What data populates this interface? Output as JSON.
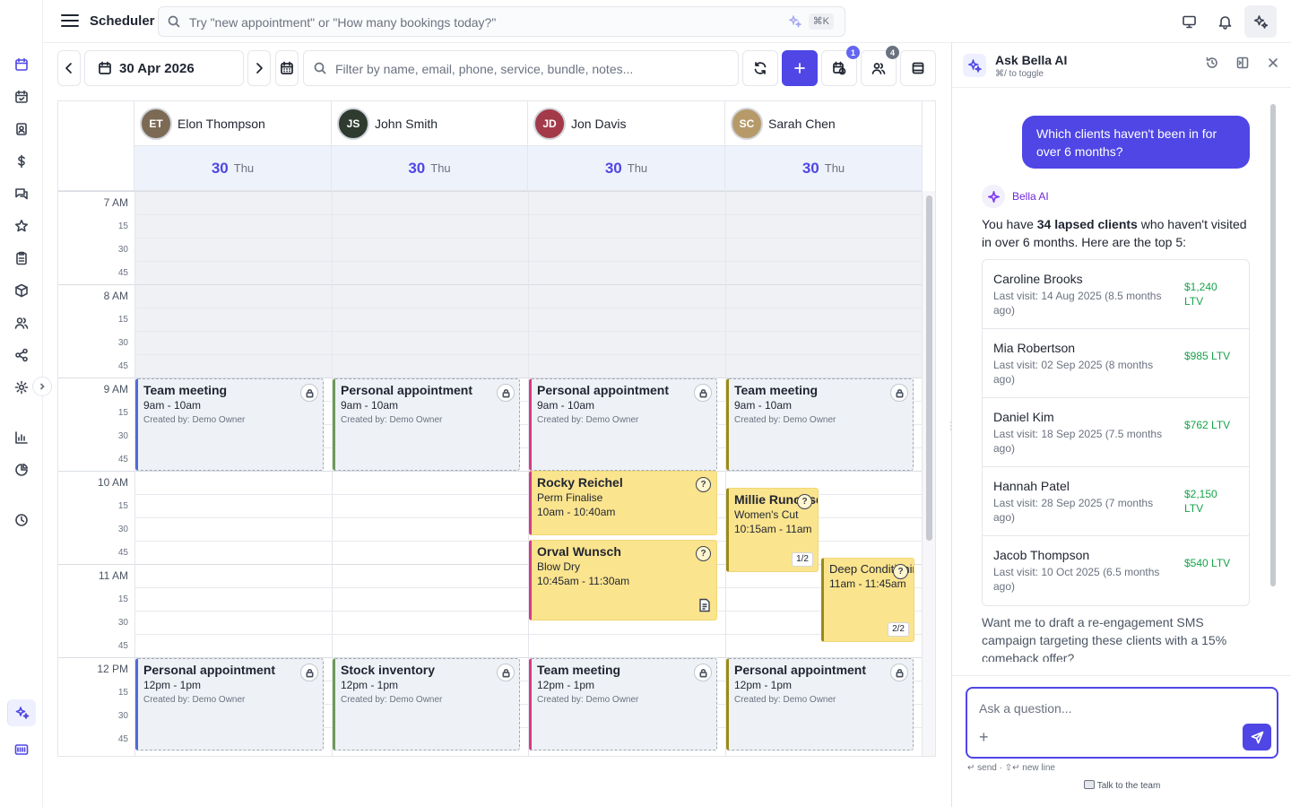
{
  "app": {
    "title": "Scheduler",
    "search_placeholder": "Try \"new appointment\" or \"How many bookings today?\"",
    "search_shortcut": "⌘K"
  },
  "rail": {
    "icons": [
      "calendar-icon",
      "calendar-check-icon",
      "contact-card-icon",
      "dollar-icon",
      "chat-icon",
      "star-icon",
      "clipboard-icon",
      "package-icon",
      "users-icon",
      "share-icon",
      "gear-icon",
      "bar-chart-icon",
      "pie-chart-icon",
      "clock-icon",
      "sparkles-icon",
      "keyboard-icon"
    ]
  },
  "toolbar": {
    "date": "30 Apr 2026",
    "filter_placeholder": "Filter by name, email, phone, service, bundle, notes...",
    "waitlist_badge": "1",
    "staff_badge": "4"
  },
  "calendar": {
    "staff": [
      {
        "name": "Elon Thompson",
        "initials": "ET",
        "color": "#7c6a55"
      },
      {
        "name": "John Smith",
        "initials": "JS",
        "color": "#2f3b2f"
      },
      {
        "name": "Jon Davis",
        "initials": "JD",
        "color": "#a33a4a"
      },
      {
        "name": "Sarah Chen",
        "initials": "SC",
        "color": "#b69a6a"
      }
    ],
    "day_number": "30",
    "weekday": "Thu",
    "hours": [
      "7 AM",
      "8 AM",
      "9 AM",
      "10 AM",
      "11 AM",
      "12 PM"
    ],
    "quarters": [
      "15",
      "30",
      "45"
    ],
    "blocks": {
      "team_meeting": "Team meeting",
      "personal": "Personal appointment",
      "stock": "Stock inventory",
      "time_9": "9am - 10am",
      "time_12": "12pm - 1pm",
      "created_by": "Created by: Demo Owner"
    },
    "bookings": [
      {
        "client": "Rocky Reichel",
        "service": "Perm Finalise",
        "time": "10am - 10:40am"
      },
      {
        "client": "Orval Wunsch",
        "service": "Blow Dry",
        "time": "10:45am - 11:30am"
      },
      {
        "client": "Millie Runolfsdottir",
        "service": "Women's Cut",
        "time": "10:15am - 11am",
        "count": "1/2"
      },
      {
        "client": "Deep Conditioning",
        "service": "",
        "time": "11am - 11:45am",
        "count": "2/2"
      }
    ]
  },
  "ai": {
    "title": "Ask Bella AI",
    "shortcut": "⌘/ to toggle",
    "user_message": "Which clients haven't been in for over 6 months?",
    "bot_name": "Bella AI",
    "reply_pre": "You have ",
    "reply_bold": "34 lapsed clients",
    "reply_post": " who haven't visited in over 6 months. Here are the top 5:",
    "clients": [
      {
        "name": "Caroline Brooks",
        "visit": "Last visit: 14 Aug 2025 (8.5 months ago)",
        "ltv": "$1,240 LTV"
      },
      {
        "name": "Mia Robertson",
        "visit": "Last visit: 02 Sep 2025 (8 months ago)",
        "ltv": "$985 LTV"
      },
      {
        "name": "Daniel Kim",
        "visit": "Last visit: 18 Sep 2025 (7.5 months ago)",
        "ltv": "$762 LTV"
      },
      {
        "name": "Hannah Patel",
        "visit": "Last visit: 28 Sep 2025 (7 months ago)",
        "ltv": "$2,150 LTV"
      },
      {
        "name": "Jacob Thompson",
        "visit": "Last visit: 10 Oct 2025 (6.5 months ago)",
        "ltv": "$540 LTV"
      }
    ],
    "followup": "Want me to draft a re-engagement SMS campaign targeting these clients with a 15% comeback offer?",
    "input_placeholder": "Ask a question...",
    "hint": "↵ send · ⇧↵ new line",
    "talk": "Talk to the team"
  },
  "colors": {
    "accent": "#4f46e5",
    "booking": "#fbe48e",
    "ltv": "#16a34a"
  }
}
